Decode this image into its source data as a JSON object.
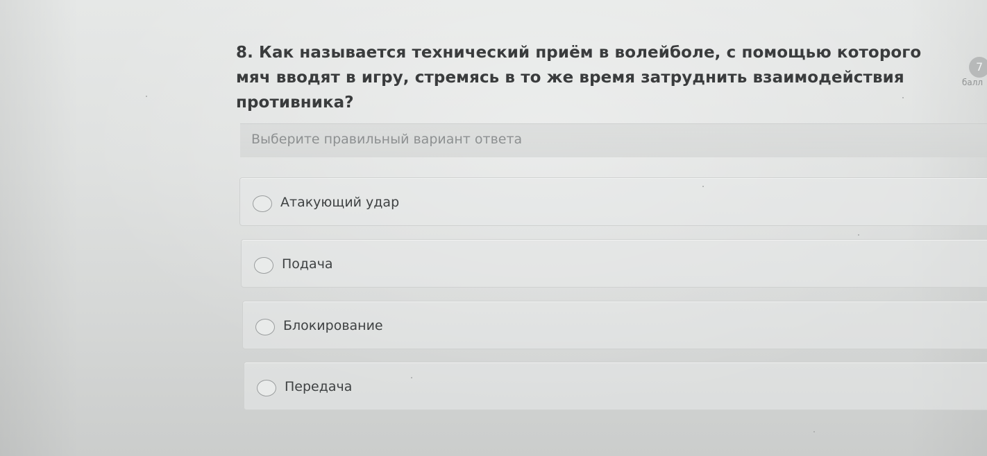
{
  "quiz": {
    "question": "8. Как называется технический приём в волейболе, с помощью которого мяч вводят в игру, стремясь в то же время затруднить взаимодействия противника?",
    "instruction": "Выберите правильный вариант ответа",
    "score_value": "7",
    "score_label": "балл",
    "options": [
      {
        "label": "Атакующий удар"
      },
      {
        "label": "Подача"
      },
      {
        "label": "Блокирование"
      },
      {
        "label": "Передача"
      }
    ]
  },
  "colors": {
    "text_primary": "#3a3c3d",
    "text_muted": "#8d9091",
    "radio_border": "#9a9d9e",
    "badge": "#b7b9b9"
  }
}
